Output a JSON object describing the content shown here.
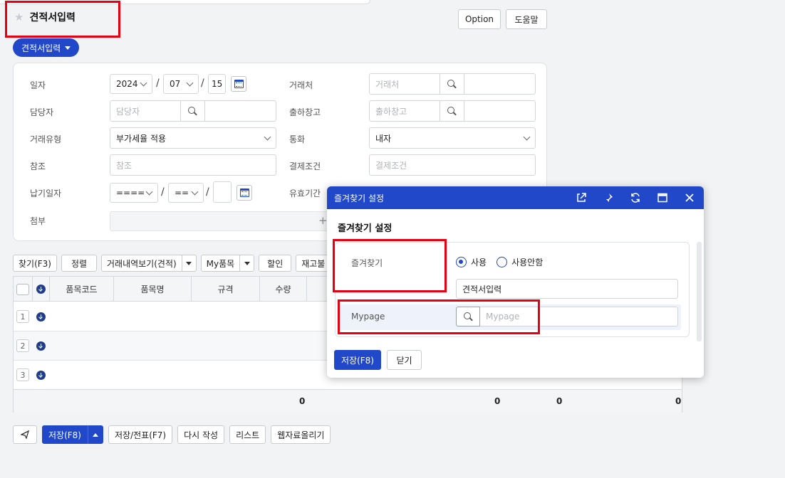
{
  "header": {
    "title": "견적서입력",
    "option_label": "Option",
    "help_label": "도움말",
    "menu_pill": "견적서입력"
  },
  "form": {
    "date_label": "일자",
    "date_year": "2024",
    "date_month": "07",
    "date_day": "15",
    "manager_label": "담당자",
    "manager_placeholder": "담당자",
    "trade_type_label": "거래유형",
    "trade_type_value": "부가세율 적용",
    "reference_label": "참조",
    "reference_placeholder": "참조",
    "delivery_label": "납기일자",
    "delivery_year": "====",
    "delivery_month": "==",
    "attach_label": "첨부",
    "client_label": "거래처",
    "client_placeholder": "거래처",
    "warehouse_label": "출하창고",
    "warehouse_placeholder": "출하창고",
    "currency_label": "통화",
    "currency_value": "내자",
    "payment_label": "결제조건",
    "payment_placeholder": "결제조건",
    "valid_label": "유효기간"
  },
  "toolbar": {
    "find": "찾기(F3)",
    "sort": "정렬",
    "history": "거래내역보기(견적)",
    "my_item": "My품목",
    "discount": "할인",
    "stock": "재고불"
  },
  "grid": {
    "columns": [
      "품목코드",
      "품목명",
      "규격",
      "수량"
    ],
    "rows": [
      "1",
      "2",
      "3"
    ],
    "totals": [
      "0",
      "0",
      "0",
      "0"
    ]
  },
  "footer": {
    "save": "저장(F8)",
    "save_slip": "저장/전표(F7)",
    "rewrite": "다시 작성",
    "list": "리스트",
    "web_upload": "웹자료올리기"
  },
  "modal": {
    "title": "즐겨찾기 설정",
    "subtitle": "즐겨찾기 설정",
    "fav_label": "즐겨찾기",
    "use_label": "사용",
    "unuse_label": "사용안함",
    "fav_name": "견적서입력",
    "mypage_label": "Mypage",
    "mypage_placeholder": "Mypage",
    "save_label": "저장(F8)",
    "close_label": "닫기"
  },
  "colors": {
    "primary": "#2148c8",
    "highlight": "#e60012"
  }
}
